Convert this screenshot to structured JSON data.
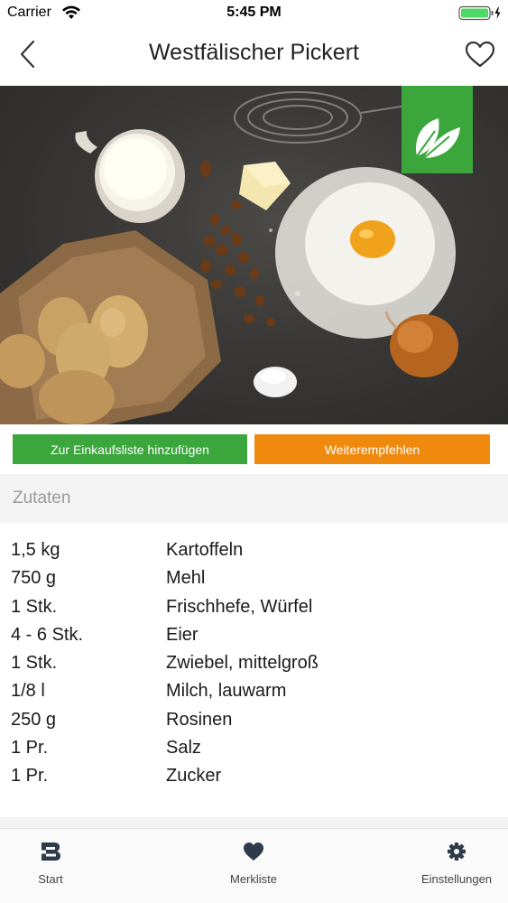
{
  "status_bar": {
    "carrier": "Carrier",
    "time": "5:45 PM"
  },
  "nav": {
    "title": "Westfälischer Pickert",
    "back_icon": "chevron-left-icon",
    "favorite_icon": "heart-outline-icon"
  },
  "hero": {
    "badge_icon": "leaf-icon",
    "badge_color": "#3aa63b"
  },
  "actions": {
    "shopping_list_label": "Zur Einkaufsliste hinzufügen",
    "shopping_list_color": "#3aa63b",
    "recommend_label": "Weiterempfehlen",
    "recommend_color": "#ef8a0f"
  },
  "ingredients_section": {
    "title": "Zutaten",
    "items": [
      {
        "amount": "1,5 kg",
        "name": "Kartoffeln"
      },
      {
        "amount": "750 g",
        "name": "Mehl"
      },
      {
        "amount": "1 Stk.",
        "name": "Frischhefe, Würfel"
      },
      {
        "amount": "4 - 6 Stk.",
        "name": "Eier"
      },
      {
        "amount": "1 Stk.",
        "name": "Zwiebel, mittelgroß"
      },
      {
        "amount": "1/8 l",
        "name": "Milch, lauwarm"
      },
      {
        "amount": "250 g",
        "name": "Rosinen"
      },
      {
        "amount": "1 Pr.",
        "name": "Salz"
      },
      {
        "amount": "1 Pr.",
        "name": "Zucker"
      }
    ]
  },
  "tab_bar": {
    "tabs": [
      {
        "label": "Start",
        "icon": "b-logo-icon"
      },
      {
        "label": "Merkliste",
        "icon": "heart-icon"
      },
      {
        "label": "Einstellungen",
        "icon": "gear-icon"
      }
    ]
  }
}
